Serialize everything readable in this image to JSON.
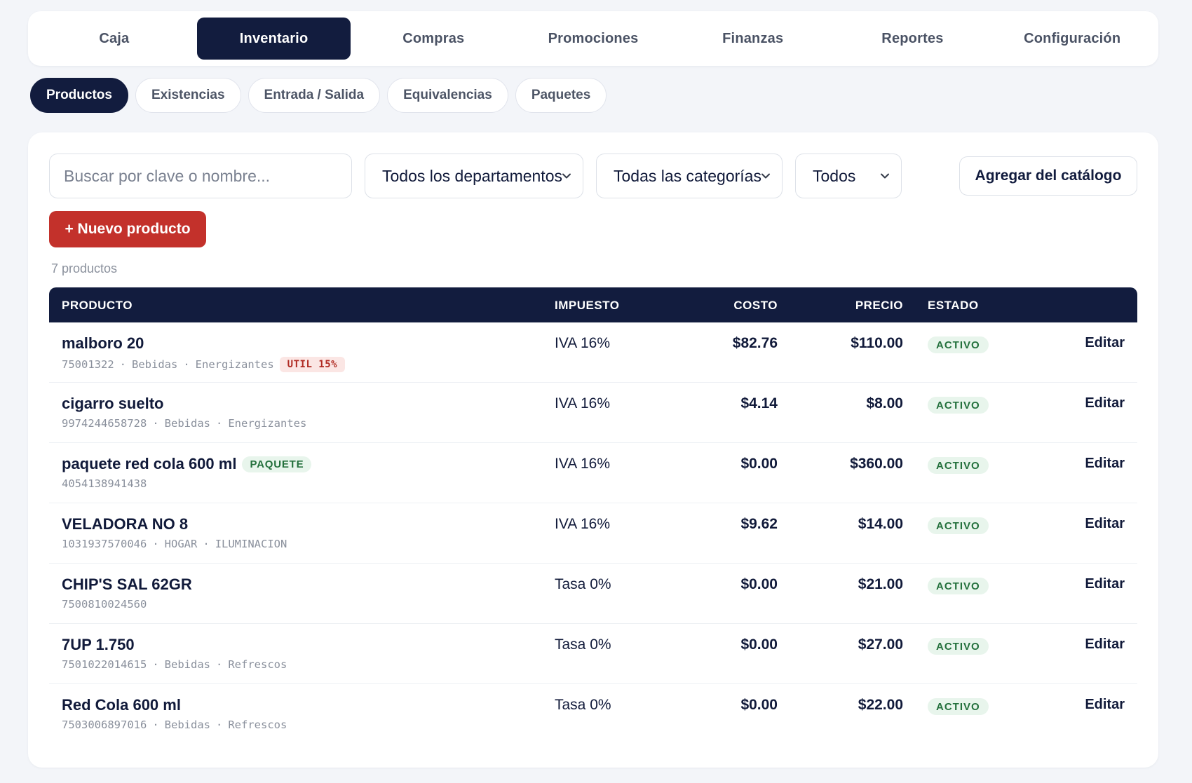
{
  "top_tabs": [
    {
      "label": "Caja"
    },
    {
      "label": "Inventario",
      "active": true
    },
    {
      "label": "Compras"
    },
    {
      "label": "Promociones"
    },
    {
      "label": "Finanzas"
    },
    {
      "label": "Reportes"
    },
    {
      "label": "Configuración"
    }
  ],
  "sub_tabs": [
    {
      "label": "Productos",
      "active": true
    },
    {
      "label": "Existencias"
    },
    {
      "label": "Entrada / Salida"
    },
    {
      "label": "Equivalencias"
    },
    {
      "label": "Paquetes"
    }
  ],
  "filters": {
    "search_placeholder": "Buscar por clave o nombre...",
    "search_value": "",
    "department": "Todos los departamentos",
    "category": "Todas las categorías",
    "status": "Todos",
    "catalog_button": "Agregar del catálogo"
  },
  "new_product_button": "+ Nuevo producto",
  "count_label": "7 productos",
  "table": {
    "headers": {
      "product": "PRODUCTO",
      "tax": "IMPUESTO",
      "cost": "COSTO",
      "price": "PRECIO",
      "status": "ESTADO"
    },
    "edit_label": "Editar",
    "separator": "·",
    "rows": [
      {
        "name": "malboro 20",
        "code": "75001322",
        "department": "Bebidas",
        "category": "Energizantes",
        "tag": "UTIL 15%",
        "tax": "IVA 16%",
        "cost": "$82.76",
        "price": "$110.00",
        "status": "ACTIVO"
      },
      {
        "name": "cigarro suelto",
        "code": "9974244658728",
        "department": "Bebidas",
        "category": "Energizantes",
        "tax": "IVA 16%",
        "cost": "$4.14",
        "price": "$8.00",
        "status": "ACTIVO"
      },
      {
        "name": "paquete red cola 600 ml",
        "code": "4054138941438",
        "badge": "PAQUETE",
        "tax": "IVA 16%",
        "cost": "$0.00",
        "price": "$360.00",
        "status": "ACTIVO"
      },
      {
        "name": "VELADORA NO 8",
        "code": "1031937570046",
        "department": "HOGAR",
        "category": "ILUMINACION",
        "tax": "IVA 16%",
        "cost": "$9.62",
        "price": "$14.00",
        "status": "ACTIVO"
      },
      {
        "name": "CHIP'S SAL 62GR",
        "code": "7500810024560",
        "tax": "Tasa 0%",
        "cost": "$0.00",
        "price": "$21.00",
        "status": "ACTIVO"
      },
      {
        "name": "7UP 1.750",
        "code": "7501022014615",
        "department": "Bebidas",
        "category": "Refrescos",
        "tax": "Tasa 0%",
        "cost": "$0.00",
        "price": "$27.00",
        "status": "ACTIVO"
      },
      {
        "name": "Red Cola 600 ml",
        "code": "7503006897016",
        "department": "Bebidas",
        "category": "Refrescos",
        "tax": "Tasa 0%",
        "cost": "$0.00",
        "price": "$22.00",
        "status": "ACTIVO"
      }
    ]
  }
}
